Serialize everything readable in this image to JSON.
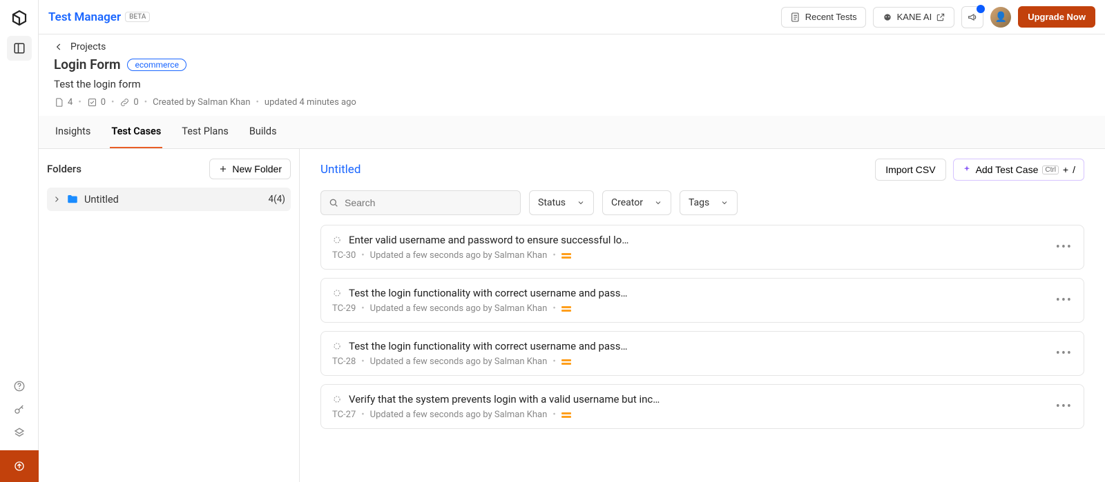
{
  "brand": {
    "name": "Test Manager",
    "badge": "BETA"
  },
  "topbar": {
    "recent_tests": "Recent Tests",
    "kane_ai": "KANE AI",
    "upgrade": "Upgrade Now"
  },
  "breadcrumb": {
    "projects": "Projects"
  },
  "project": {
    "title": "Login Form",
    "tag": "ecommerce",
    "description": "Test the login form",
    "counts": {
      "testcases": "4",
      "checked": "0",
      "linked": "0"
    },
    "created_by": "Created by Salman Khan",
    "updated": "updated 4 minutes ago"
  },
  "tabs": [
    "Insights",
    "Test Cases",
    "Test Plans",
    "Builds"
  ],
  "active_tab": 1,
  "folders": {
    "heading": "Folders",
    "new_folder": "New Folder",
    "items": [
      {
        "name": "Untitled",
        "count": "4(4)"
      }
    ]
  },
  "cases": {
    "folder_title": "Untitled",
    "import_csv": "Import CSV",
    "add_test_case": "Add Test Case",
    "kbd1": "Ctrl",
    "kbd2": "+",
    "kbd3": "/",
    "search_placeholder": "Search",
    "filters": [
      "Status",
      "Creator",
      "Tags"
    ],
    "items": [
      {
        "title": "Enter valid username and password to ensure successful lo…",
        "id": "TC-30",
        "updated": "Updated a few seconds ago by Salman Khan"
      },
      {
        "title": "Test the login functionality with correct username and pass…",
        "id": "TC-29",
        "updated": "Updated a few seconds ago by Salman Khan"
      },
      {
        "title": "Test the login functionality with correct username and pass…",
        "id": "TC-28",
        "updated": "Updated a few seconds ago by Salman Khan"
      },
      {
        "title": "Verify that the system prevents login with a valid username but inc…",
        "id": "TC-27",
        "updated": "Updated a few seconds ago by Salman Khan"
      }
    ]
  }
}
